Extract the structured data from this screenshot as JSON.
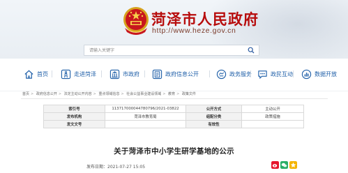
{
  "header": {
    "site_title": "菏泽市人民政府",
    "site_url": "http://www.heze.gov.cn",
    "search_placeholder": "请输入关键字"
  },
  "nav": [
    {
      "label": "首页",
      "icon": "home-icon"
    },
    {
      "label": "走进菏泽",
      "icon": "road-icon"
    },
    {
      "label": "市政府",
      "icon": "building-icon"
    },
    {
      "label": "政府信息公开",
      "icon": "document-icon"
    },
    {
      "label": "政务服务",
      "icon": "service-icon"
    },
    {
      "label": "政民互动",
      "icon": "chat-icon"
    },
    {
      "label": "数据开放",
      "icon": "data-icon"
    }
  ],
  "breadcrumb": [
    "首页",
    "政府信息公开",
    "法定主动公开内容",
    "重点领域信息",
    "社会公益事业建设领域",
    "教育",
    "政策文件"
  ],
  "info_table": {
    "rows": [
      [
        "索引号",
        "113717000044780796/2021-03822",
        "公开方式",
        "主动公开"
      ],
      [
        "发布机构",
        "菏泽市教育局",
        "组配分类",
        "政策措施"
      ],
      [
        "发文文号",
        "",
        "有效性",
        ""
      ]
    ]
  },
  "document": {
    "title": "关于菏泽市中小学生研学基地的公示",
    "publish_label": "发布日期：",
    "publish_date": "2021-07-27 15:05"
  },
  "colors": {
    "brand_red": "#b70c0c",
    "nav_blue": "#1f5fa8"
  }
}
